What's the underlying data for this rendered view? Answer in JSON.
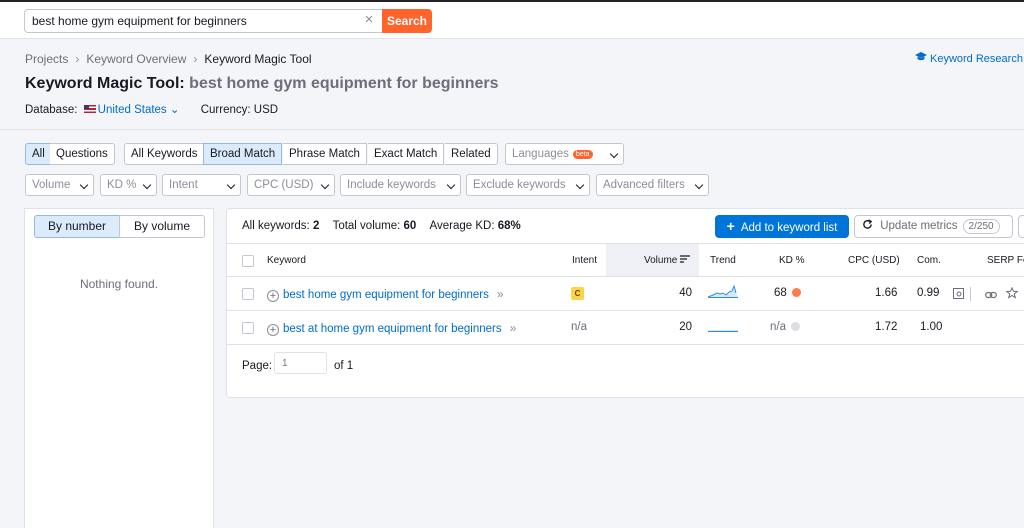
{
  "search": {
    "query": "best home gym equipment for beginners",
    "clear_icon": "close-icon",
    "button_label": "Search"
  },
  "breadcrumb": [
    "Projects",
    "Keyword Overview",
    "Keyword Magic Tool"
  ],
  "header": {
    "title_prefix": "Keyword Magic Tool:",
    "title_query": "best home gym equipment for beginners",
    "kr_link": "Keyword Research",
    "database_label": "Database:",
    "database_value": "United States",
    "currency": "Currency: USD"
  },
  "filters": {
    "row1": {
      "all": "All",
      "questions": "Questions",
      "all_keywords": "All Keywords",
      "broad_match": "Broad Match",
      "phrase_match": "Phrase Match",
      "exact_match": "Exact Match",
      "related": "Related",
      "languages": "Languages",
      "beta": "beta"
    },
    "row2": {
      "volume": "Volume",
      "kd": "KD %",
      "intent": "Intent",
      "cpc": "CPC (USD)",
      "include": "Include keywords",
      "exclude": "Exclude keywords",
      "advanced": "Advanced filters"
    }
  },
  "left_panel": {
    "by_number": "By number",
    "by_volume": "By volume",
    "empty": "Nothing found."
  },
  "summary": {
    "all_keywords_label": "All keywords:",
    "all_keywords_value": "2",
    "total_volume_label": "Total volume:",
    "total_volume_value": "60",
    "avg_kd_label": "Average KD:",
    "avg_kd_value": "68%"
  },
  "actions": {
    "add_label": "Add to keyword list",
    "update_label": "Update metrics",
    "update_count": "2/250"
  },
  "table": {
    "headers": {
      "keyword": "Keyword",
      "intent": "Intent",
      "volume": "Volume",
      "trend": "Trend",
      "kd": "KD %",
      "cpc": "CPC (USD)",
      "com": "Com.",
      "serp": "SERP Fe"
    },
    "rows": [
      {
        "keyword": "best home gym equipment for beginners",
        "intent": "C",
        "volume": "40",
        "kd": "68",
        "kd_color": "#ff7b4a",
        "cpc": "1.66",
        "com": "0.99"
      },
      {
        "keyword": "best at home gym equipment for beginners",
        "intent": "n/a",
        "volume": "20",
        "kd": "n/a",
        "kd_color": "#dcdde3",
        "cpc": "1.72",
        "com": "1.00"
      }
    ]
  },
  "pager": {
    "label": "Page:",
    "placeholder": "1",
    "of": "of 1"
  },
  "colors": {
    "accent": "#ff642d",
    "primary": "#0075d9",
    "link": "#006dca"
  }
}
